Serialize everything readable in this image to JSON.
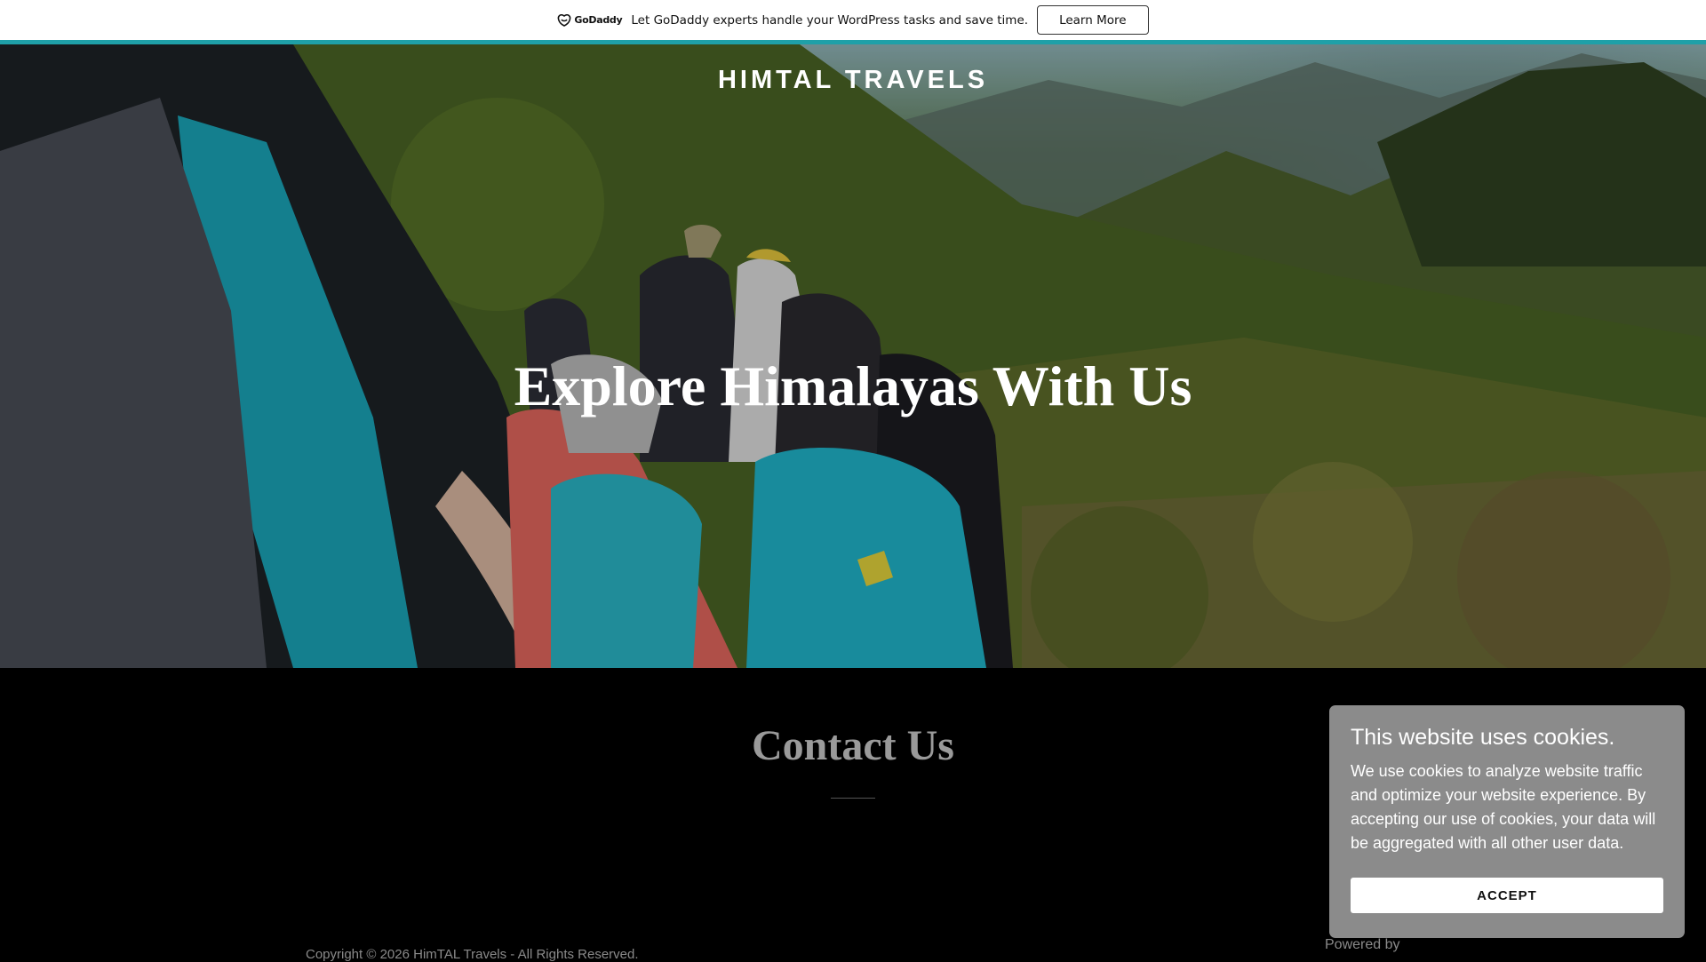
{
  "promo": {
    "logo_text": "GoDaddy",
    "message": "Let GoDaddy experts handle your WordPress tasks and save time.",
    "button_label": "Learn More",
    "accent_color": "#1fa0a8"
  },
  "hero": {
    "site_title": "HIMTAL TRAVELS",
    "heading": "Explore Himalayas With Us"
  },
  "contact": {
    "title": "Contact Us"
  },
  "footer": {
    "copyright": "Copyright © 2026 HimTAL Travels - All Rights Reserved.",
    "powered_by": "Powered by"
  },
  "cookie_banner": {
    "title": "This website uses cookies.",
    "body": "We use cookies to analyze website traffic and optimize your website experience. By accepting our use of cookies, your data will be aggregated with all other user data.",
    "accept_label": "ACCEPT"
  }
}
